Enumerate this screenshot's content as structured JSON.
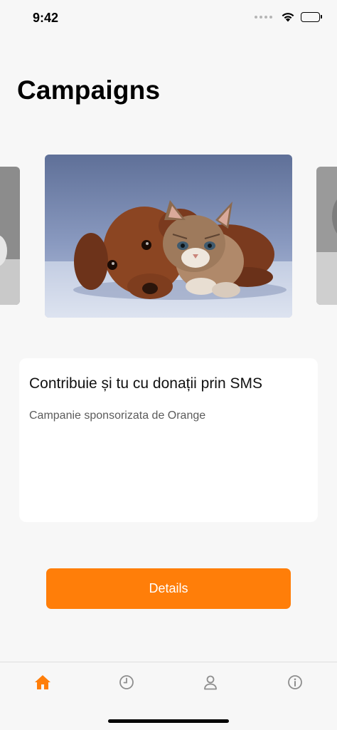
{
  "status_bar": {
    "time": "9:42"
  },
  "page": {
    "title": "Campaigns"
  },
  "campaign": {
    "title": "Contribuie și tu cu donații prin SMS",
    "subtitle": "Campanie sponsorizata de Orange"
  },
  "actions": {
    "details_label": "Details"
  },
  "tab_bar": {
    "items": [
      {
        "icon": "home-icon",
        "active": true
      },
      {
        "icon": "clock-icon",
        "active": false
      },
      {
        "icon": "person-icon",
        "active": false
      },
      {
        "icon": "info-icon",
        "active": false
      }
    ]
  },
  "colors": {
    "accent": "#ff7e09",
    "inactive_tab": "#8e8e8e",
    "background": "#f7f7f7"
  }
}
